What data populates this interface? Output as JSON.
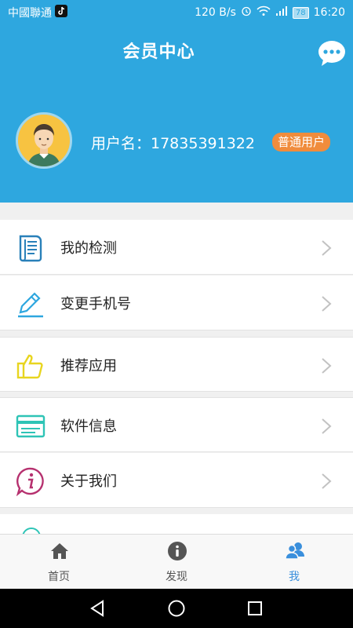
{
  "status_bar": {
    "carrier": "中國聯通",
    "speed": "120 B/s",
    "battery": "78",
    "time": "16:20",
    "carrier_icon": "tiktok-icon",
    "right_icons": [
      "alarm-icon",
      "wifi-icon",
      "signal-icon",
      "battery-icon"
    ]
  },
  "header": {
    "title": "会员中心",
    "bg_color": "#2ea7df",
    "chat_icon": "chat-bubble-icon"
  },
  "profile": {
    "username": "用户名：17835391322",
    "badge": "普通用户",
    "badge_color": "#f08c3c",
    "avatar_icon": "avatar-icon"
  },
  "menu": {
    "items": [
      {
        "label": "我的检测",
        "icon": "document-list-icon"
      },
      {
        "label": "变更手机号",
        "icon": "pencil-icon"
      },
      {
        "label": "推荐应用",
        "icon": "thumbs-up-icon"
      },
      {
        "label": "软件信息",
        "icon": "card-icon"
      },
      {
        "label": "关于我们",
        "icon": "info-bubble-icon"
      }
    ]
  },
  "tabbar": {
    "tabs": [
      {
        "label": "首页",
        "icon": "home-icon",
        "active": false
      },
      {
        "label": "发现",
        "icon": "info-circle-icon",
        "active": false
      },
      {
        "label": "我",
        "icon": "users-icon",
        "active": true
      }
    ],
    "active_color": "#3a8fdc"
  },
  "nav_bar": {
    "buttons": [
      "back-triangle-icon",
      "home-circle-icon",
      "recents-square-icon"
    ]
  }
}
